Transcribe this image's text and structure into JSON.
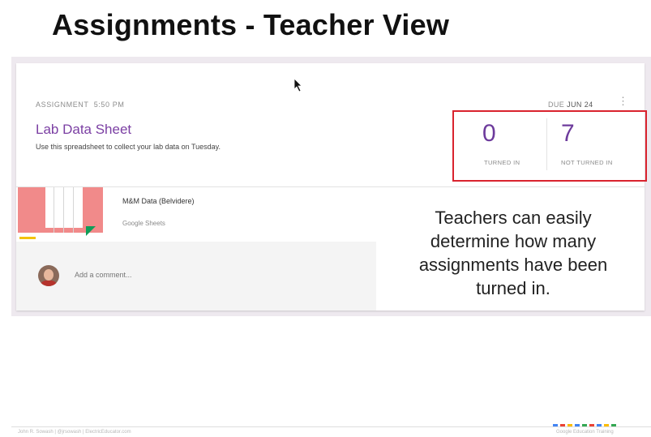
{
  "slide": {
    "title": "Assignments - Teacher View"
  },
  "assignment": {
    "header_label": "ASSIGNMENT",
    "header_time": "5:50 PM",
    "due_prefix": "DUE",
    "due_date": "JUN 24",
    "title": "Lab Data Sheet",
    "description": "Use this spreadsheet to collect your lab data on Tuesday."
  },
  "stats": {
    "turned_in_count": "0",
    "turned_in_label": "TURNED IN",
    "not_turned_in_count": "7",
    "not_turned_in_label": "NOT TURNED IN"
  },
  "attachment": {
    "name": "M&M Data (Belvidere)",
    "type": "Google Sheets"
  },
  "comment": {
    "placeholder": "Add a comment..."
  },
  "caption": {
    "line1": "Teachers can easily",
    "line2": "determine how many",
    "line3": "assignments have been",
    "line4": "turned in."
  },
  "footer": {
    "left": "John R. Sowash | @jrsowash | ElectricEducator.com",
    "right": "Google Education Training"
  },
  "colors": {
    "accent_purple": "#7b3fa3",
    "highlight_red": "#d9232e",
    "dots": [
      "#4285f4",
      "#ea4335",
      "#fbbc05",
      "#4285f4",
      "#34a853",
      "#ea4335",
      "#4285f4",
      "#fbbc05",
      "#34a853"
    ]
  },
  "icons": {
    "cursor": "mouse-pointer-icon",
    "menu": "kebab-menu-icon",
    "sheet": "google-sheets-thumbnail"
  }
}
